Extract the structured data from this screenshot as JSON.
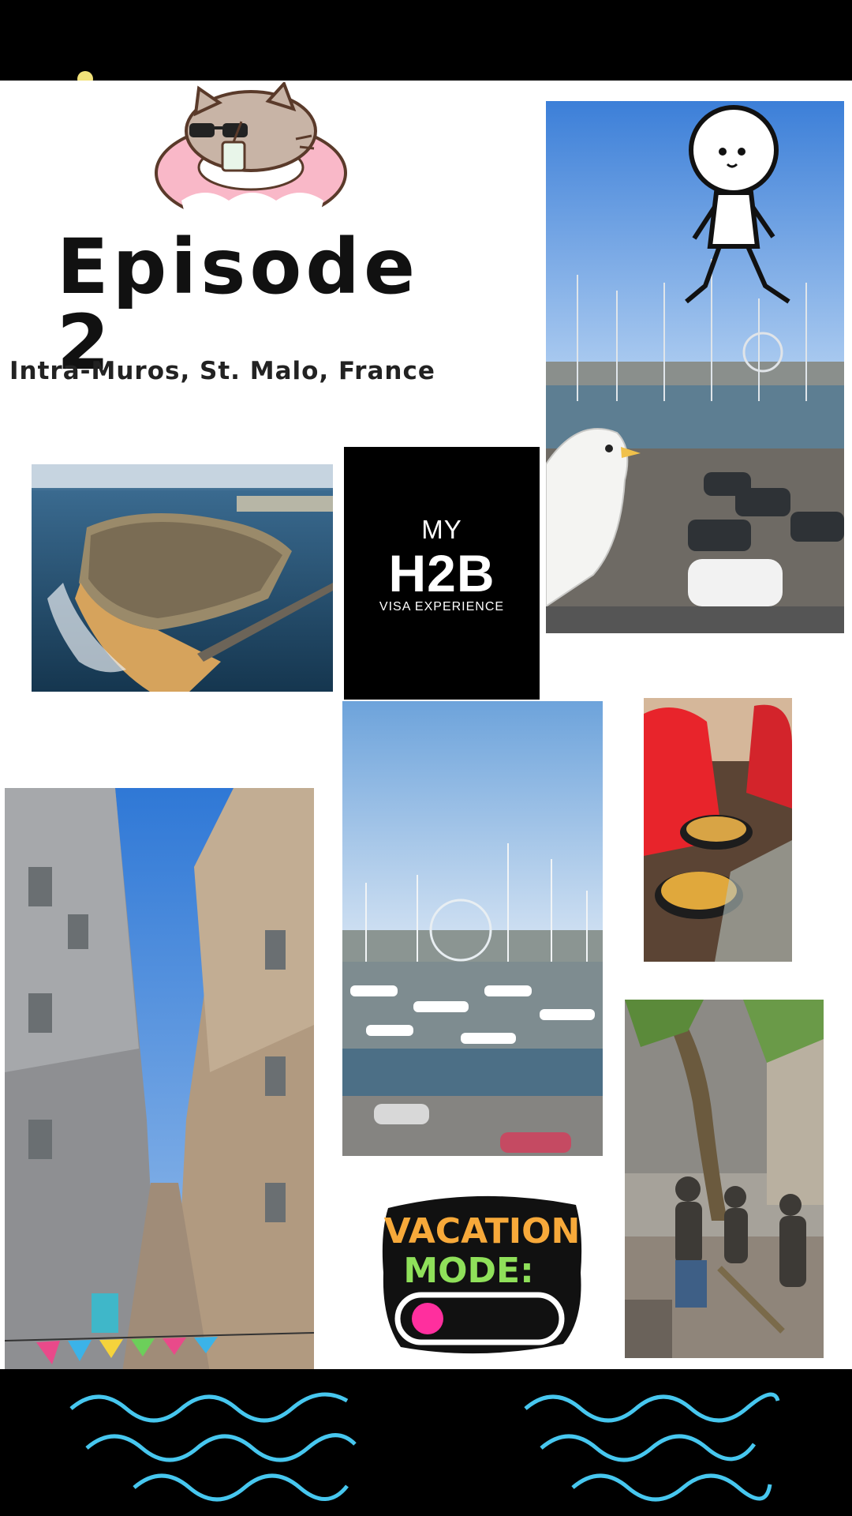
{
  "story": {
    "title": "Episode 2",
    "subtitle": "Intra-Muros, St. Malo, France"
  },
  "logo": {
    "line1": "MY",
    "line2": "H2B",
    "line3": "VISA EXPERIENCE"
  },
  "sticker": {
    "line1": "VACATION",
    "line2": "MODE:",
    "toggle_color": "#ff2f9e"
  },
  "colors": {
    "background": "#ffffff",
    "frame": "#000000",
    "waves": "#47c7ef"
  }
}
